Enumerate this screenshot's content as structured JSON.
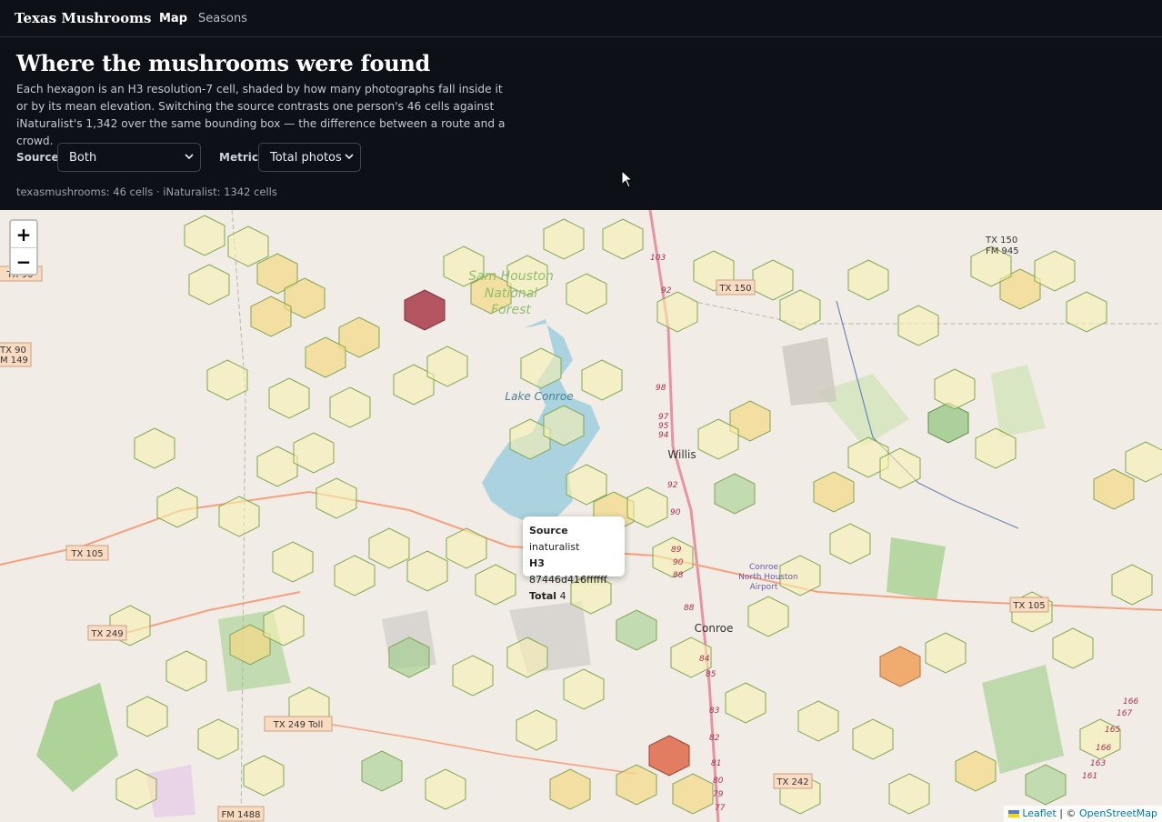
{
  "nav": {
    "brand": "Texas Mushrooms",
    "items": [
      {
        "label": "Map",
        "active": true
      },
      {
        "label": "Seasons",
        "active": false
      }
    ]
  },
  "header": {
    "title": "Where the mushrooms were found",
    "intro": "Each hexagon is an H3 resolution-7 cell, shaded by how many photographs fall inside it or by its mean elevation. Switching the source contrasts one person's 46 cells against iNaturalist's 1,342 over the same bounding box — the difference between a route and a crowd."
  },
  "controls": {
    "source_label": "Source",
    "source_value": "Both",
    "metric_label": "Metric",
    "metric_value": "Total photos",
    "counts": "texasmushrooms: 46 cells · iNaturalist: 1342 cells"
  },
  "map": {
    "zoom_in": "+",
    "zoom_out": "−",
    "labels": {
      "forest": [
        "Sam Houston",
        "National",
        "Forest"
      ],
      "lake": "Lake Conroe",
      "willis": "Willis",
      "conroe": "Conroe",
      "airport": [
        "Conroe",
        "North Houston",
        "Airport"
      ]
    },
    "shields": [
      "TX 90",
      "M 149",
      "TX 105",
      "TX 249",
      "TX 249 Toll",
      "FM 1488",
      "TX 150",
      "TX 242",
      "TX 105",
      "TX 150",
      "FM 945"
    ],
    "route_numbers": [
      "103",
      "92",
      "98",
      "97",
      "95",
      "94",
      "92",
      "90",
      "89",
      "90",
      "88",
      "88",
      "84",
      "85",
      "83",
      "82",
      "81",
      "80",
      "79",
      "77",
      "166",
      "167",
      "165",
      "166",
      "163",
      "161"
    ],
    "popup": {
      "source_key": "Source",
      "source_val": "inaturalist",
      "h3_key": "H3",
      "h3_val": "87446d416ffffff",
      "total_key": "Total",
      "total_val": "4"
    },
    "attribution": {
      "leaflet": "Leaflet",
      "sep": "| ©",
      "osm": "OpenStreetMap"
    }
  },
  "colors": {
    "hex_low": "#f7f0b0",
    "hex_mid": "#f5d884",
    "hex_orange": "#f09a50",
    "hex_red": "#e06040",
    "hex_dark": "#a83848",
    "hex_green": "#8fc37a",
    "accent_link": "#0078a8"
  }
}
